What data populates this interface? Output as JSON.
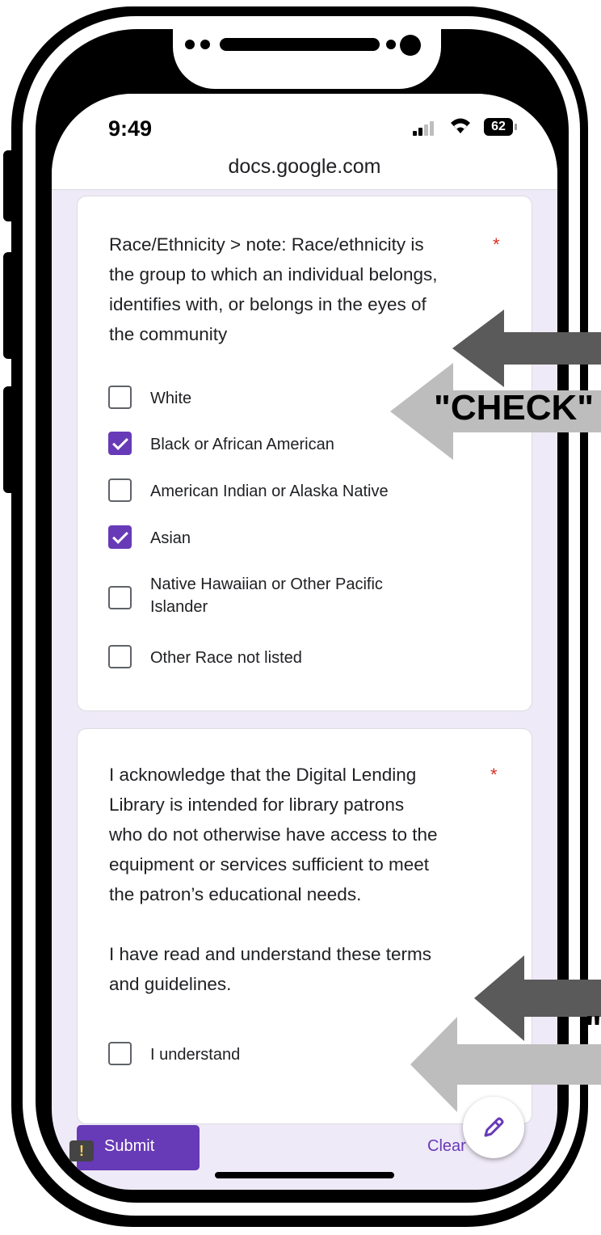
{
  "status_bar": {
    "time": "9:49",
    "battery": "62"
  },
  "browser": {
    "url": "docs.google.com"
  },
  "question1": {
    "title": "Race/Ethnicity  >  note:  Race/ethnicity is the group to which an individual belongs, identifies with, or belongs in the eyes of the community",
    "title_lines": [
      "Race/Ethnicity  >  note:  Race/ethnicity is",
      "the group to which an individual belongs,",
      "identifies with, or belongs in the eyes of",
      "the community"
    ],
    "required_mark": "*",
    "options": [
      {
        "label": "White",
        "checked": false
      },
      {
        "label": "Black or African American",
        "checked": true
      },
      {
        "label": "American Indian or Alaska Native",
        "checked": false
      },
      {
        "label": "Asian",
        "checked": true
      },
      {
        "label": "Native Hawaiian or Other Pacific Islander",
        "label_lines": [
          "Native Hawaiian or Other Pacific",
          "Islander"
        ],
        "checked": false
      },
      {
        "label": "Other Race not listed",
        "checked": false
      }
    ]
  },
  "question2": {
    "title_lines": [
      "I acknowledge that the Digital Lending",
      "Library is intended for library patrons",
      "who do not otherwise have access to the",
      "equipment or services sufficient to meet",
      "the patron’s educational needs."
    ],
    "title_lines_2": [
      "I have read and understand these terms",
      "and guidelines."
    ],
    "required_mark": "*",
    "options": [
      {
        "label": "I understand",
        "checked": false
      }
    ]
  },
  "footer": {
    "submit_label": "Submit",
    "clear_label": "Clear"
  },
  "annotations": {
    "check_text": "\"CHECK\"",
    "second_text": "\""
  },
  "colors": {
    "accent": "#673ab7",
    "required": "#d93025",
    "arrow_dark": "#5a5a5a",
    "arrow_light": "#bdbdbd"
  }
}
